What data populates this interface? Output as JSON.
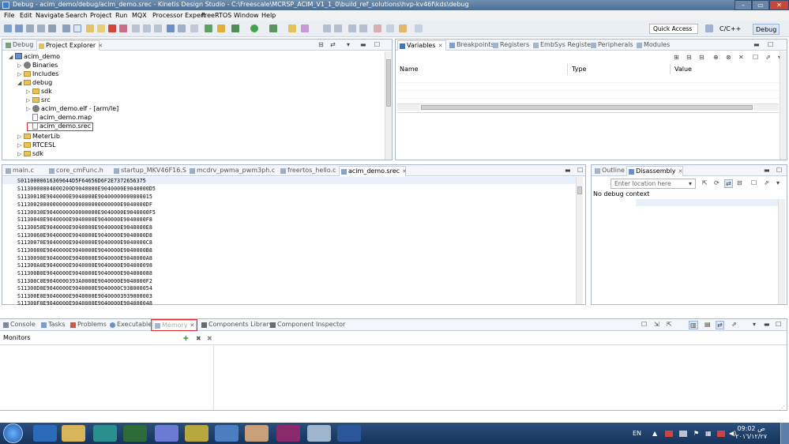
{
  "window": {
    "title": "Debug - acim_demo/debug/acim_demo.srec - Kinetis Design Studio - C:\\Freescale\\MCRSP_ACIM_V1_1_0\\build_ref_solutions\\hvp-kv46f\\kds\\debug",
    "min": "–",
    "max": "▭",
    "close": "✕"
  },
  "menu": [
    "File",
    "Edit",
    "Navigate",
    "Search",
    "Project",
    "Run",
    "MQX",
    "Processor Expert",
    "FreeRTOS",
    "Window",
    "Help"
  ],
  "toolbar": {
    "quick_access_placeholder": "Quick Access",
    "perspectives": [
      "C/C++",
      "Debug"
    ]
  },
  "explorer": {
    "tabs": [
      {
        "label": "Debug"
      },
      {
        "label": "Project Explorer"
      }
    ],
    "tree": [
      {
        "label": "acim_demo",
        "depth": 0,
        "arrow": "◢",
        "icon": "project"
      },
      {
        "label": "Binaries",
        "depth": 1,
        "arrow": "▷",
        "icon": "gear"
      },
      {
        "label": "Includes",
        "depth": 1,
        "arrow": "▷",
        "icon": "folder"
      },
      {
        "label": "debug",
        "depth": 1,
        "arrow": "◢",
        "icon": "folder"
      },
      {
        "label": "sdk",
        "depth": 2,
        "arrow": "▷",
        "icon": "folder"
      },
      {
        "label": "src",
        "depth": 2,
        "arrow": "▷",
        "icon": "folder"
      },
      {
        "label": "acim_demo.elf - [arm/le]",
        "depth": 2,
        "arrow": "▷",
        "icon": "gear"
      },
      {
        "label": "acim_demo.map",
        "depth": 2,
        "arrow": "",
        "icon": "file"
      },
      {
        "label": "acim_demo.srec",
        "depth": 2,
        "arrow": "",
        "icon": "file"
      },
      {
        "label": "MeterLib",
        "depth": 1,
        "arrow": "▷",
        "icon": "folder"
      },
      {
        "label": "RTCESL",
        "depth": 1,
        "arrow": "▷",
        "icon": "folder"
      },
      {
        "label": "sdk",
        "depth": 1,
        "arrow": "▷",
        "icon": "folder"
      }
    ]
  },
  "variables": {
    "tabs": [
      "Variables",
      "Breakpoints",
      "Registers",
      "EmbSys Registers",
      "Peripherals",
      "Modules"
    ],
    "columns": [
      "Name",
      "Type",
      "Value"
    ]
  },
  "editor": {
    "tabs": [
      "main.c",
      "core_cmFunc.h",
      "startup_MKV46F16.S",
      "mcdrv_pwma_pwm3ph.c",
      "freertos_hello.c",
      "acim_demo.srec"
    ],
    "lines": [
      "S0110000616369644D5F64656D6F2E7372656375",
      "S1130000004000200D9040000E9040000E9040000D5",
      "S1130010E9040000E9040000E90400000000000015",
      "S1130020000000000000000000000000E9040000DF",
      "S1130030E9040000000000000E9040000E9040000F5",
      "S1130040E9040000E9040000E9040000E9040000F8",
      "S1130050E9040000E9040000E9040000E9040000E8",
      "S1130060E9040000E9040000E9040000E9040000D8",
      "S1130070E9040000E9040000E9040000E9040000C8",
      "S1130080E9040000E9040000E9040000E9040000B8",
      "S1130090E9040000E9040000E9040000E9040000A8",
      "S11300A0E9040000E9040000E9040000E904000098",
      "S11300B0E9040000E9040000E9040000E904000088",
      "S11300C0E9040000393A0000E9040000E9040000F2",
      "S11300D0E9040000E9040000E9040000C938000054",
      "S11300E0E9040000E9040000E90400003939000003",
      "S11300F0E9040000E9040000E9040000E904000048"
    ]
  },
  "disassembly": {
    "tabs": [
      "Outline",
      "Disassembly"
    ],
    "location_placeholder": "Enter location here",
    "message": "No debug context"
  },
  "console": {
    "tabs": [
      "Console",
      "Tasks",
      "Problems",
      "Executables",
      "Memory",
      "Components Library",
      "Component Inspector"
    ],
    "monitors_label": "Monitors"
  },
  "taskbar": {
    "lang": "EN",
    "time": "09:02 ص",
    "date": "۲۰۱٦/۱۲/۲۷"
  },
  "colors": {
    "titlebar": "#4a6d93",
    "highlight": "#e0262c",
    "taskbar": "#1e3f6a"
  }
}
